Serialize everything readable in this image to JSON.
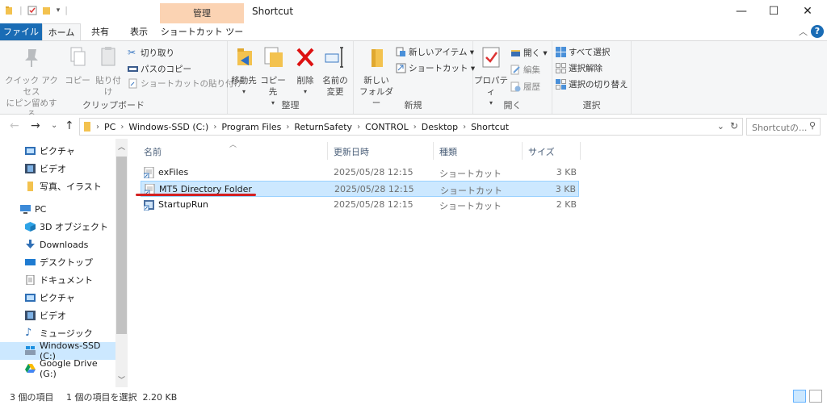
{
  "window": {
    "title": "Shortcut",
    "context_tab_group": "管理",
    "minimize_icon": "minimize-icon",
    "maximize_icon": "maximize-icon",
    "close_icon": "close-icon"
  },
  "tabs": {
    "file": "ファイル",
    "home": "ホーム",
    "share": "共有",
    "view": "表示",
    "shortcut_tools": "ショートカット ツール"
  },
  "ribbon": {
    "clipboard": {
      "label": "クリップボード",
      "pin": "クイック アクセス\nにピン留めする",
      "copy": "コピー",
      "paste": "貼り付け",
      "cut": "切り取り",
      "copy_path": "パスのコピー",
      "paste_shortcut": "ショートカットの貼り付け"
    },
    "organize": {
      "label": "整理",
      "move_to": "移動先",
      "copy_to": "コピー先",
      "delete": "削除",
      "rename": "名前の\n変更"
    },
    "new": {
      "label": "新規",
      "new_folder": "新しい\nフォルダー",
      "new_item": "新しいアイテム ▾",
      "easy_access": "ショートカット ▾"
    },
    "open": {
      "label": "開く",
      "properties": "プロパティ",
      "open": "開く ▾",
      "edit": "編集",
      "history": "履歴"
    },
    "select": {
      "label": "選択",
      "select_all": "すべて選択",
      "select_none": "選択解除",
      "invert": "選択の切り替え"
    }
  },
  "address": {
    "crumbs": [
      "PC",
      "Windows-SSD (C:)",
      "Program Files",
      "ReturnSafety",
      "CONTROL",
      "Desktop",
      "Shortcut"
    ],
    "search_placeholder": "Shortcutの..."
  },
  "navpane": {
    "items": [
      {
        "label": "ピクチャ",
        "icon": "pictures-icon"
      },
      {
        "label": "ビデオ",
        "icon": "videos-icon"
      },
      {
        "label": "写真、イラスト",
        "icon": "folder-icon"
      },
      {
        "label": "PC",
        "icon": "pc-icon"
      },
      {
        "label": "3D オブジェクト",
        "icon": "3d-objects-icon"
      },
      {
        "label": "Downloads",
        "icon": "downloads-icon"
      },
      {
        "label": "デスクトップ",
        "icon": "desktop-icon"
      },
      {
        "label": "ドキュメント",
        "icon": "documents-icon"
      },
      {
        "label": "ピクチャ",
        "icon": "pictures-icon"
      },
      {
        "label": "ビデオ",
        "icon": "videos-icon"
      },
      {
        "label": "ミュージック",
        "icon": "music-icon"
      },
      {
        "label": "Windows-SSD (C:)",
        "icon": "drive-icon"
      },
      {
        "label": "Google Drive (G:)",
        "icon": "google-drive-icon"
      }
    ]
  },
  "filelist": {
    "columns": {
      "name": "名前",
      "modified": "更新日時",
      "type": "種類",
      "size": "サイズ"
    },
    "rows": [
      {
        "name": "exFiles",
        "modified": "2025/05/28 12:15",
        "type": "ショートカット",
        "size": "3 KB"
      },
      {
        "name": "MT5 Directory Folder",
        "modified": "2025/05/28 12:15",
        "type": "ショートカット",
        "size": "3 KB"
      },
      {
        "name": "StartupRun",
        "modified": "2025/05/28 12:15",
        "type": "ショートカット",
        "size": "2 KB"
      }
    ]
  },
  "status": {
    "item_count": "3 個の項目",
    "selection": "1 個の項目を選択  2.20 KB"
  },
  "colors": {
    "accent": "#1a6cb5",
    "selection": "#cce8ff",
    "context_tab": "#fbd3b3",
    "annotation_underline": "#d42020"
  }
}
